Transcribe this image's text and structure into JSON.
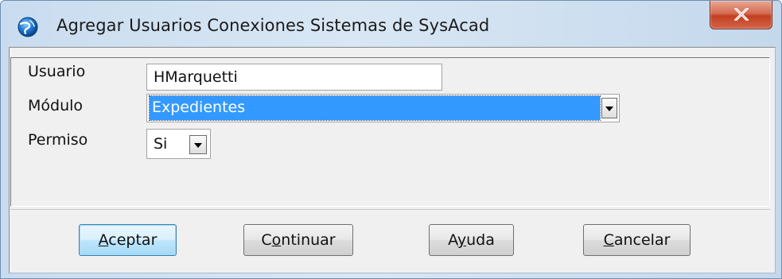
{
  "window": {
    "title": "Agregar Usuarios Conexiones Sistemas de SysAcad",
    "icon": "app-globe-icon",
    "close_icon": "close-icon"
  },
  "form": {
    "usuario": {
      "label": "Usuario",
      "value": "HMarquetti"
    },
    "modulo": {
      "label": "Módulo",
      "value": "Expedientes"
    },
    "permiso": {
      "label": "Permiso",
      "value": "Si"
    }
  },
  "buttons": {
    "aceptar": {
      "pre": "",
      "mnemonic": "A",
      "post": "ceptar"
    },
    "continuar": {
      "pre": "C",
      "mnemonic": "o",
      "post": "ntinuar"
    },
    "ayuda": {
      "pre": "A",
      "mnemonic": "y",
      "post": "uda"
    },
    "cancelar": {
      "pre": "",
      "mnemonic": "C",
      "post": "ancelar"
    }
  },
  "colors": {
    "selection": "#3399ff",
    "close_button": "#c2401f",
    "titlebar": "#c9dcef"
  }
}
